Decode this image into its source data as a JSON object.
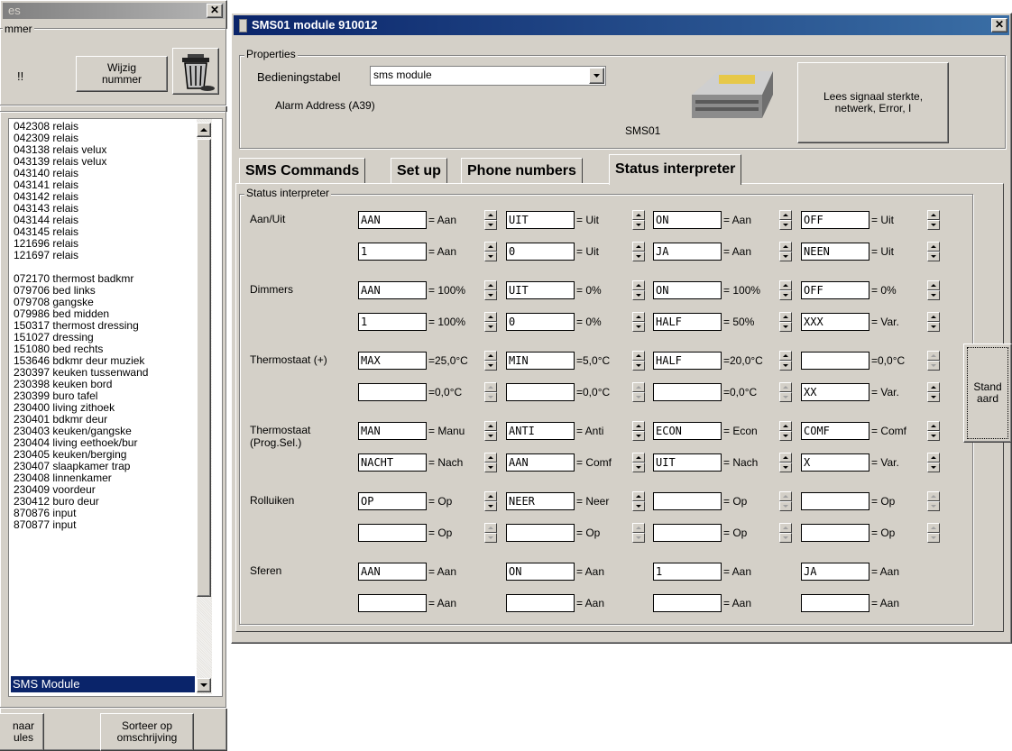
{
  "left_window": {
    "title": "es",
    "group_label": "mmer",
    "number_text": "!!",
    "wijzig_button": "Wijzig nummer",
    "list_items": [
      "042308 relais",
      "042309 relais",
      "043138 relais velux",
      "043139 relais velux",
      "043140 relais",
      "043141 relais",
      "043142 relais",
      "043143 relais",
      "043144 relais",
      "043145 relais",
      "121696 relais",
      "121697 relais",
      "",
      "072170 thermost badkmr",
      "079706 bed links",
      "079708 gangske",
      "079986 bed midden",
      "150317 thermost dressing",
      "151027 dressing",
      "151080 bed rechts",
      "153646 bdkmr deur muziek",
      "230397 keuken tussenwand",
      "230398 keuken bord",
      "230399 buro tafel",
      "230400 living zithoek",
      "230401 bdkmr deur",
      "230403 keuken/gangske",
      "230404 living eethoek/bur",
      "230405 keuken/berging",
      "230407 slaapkamer trap",
      "230408 linnenkamer",
      "230409 voordeur",
      "230412 buro deur",
      "870876 input",
      "870877 input"
    ],
    "selected_item": "SMS Module",
    "naar_button": "naar ules",
    "sorteer_button": "Sorteer op omschrijving"
  },
  "main_window": {
    "title": "SMS01 module 910012",
    "properties": {
      "group_label": "Properties",
      "bedieningstabel_label": "Bedieningstabel",
      "bedieningstabel_value": "sms module",
      "alarm_label": "Alarm Address (A39)",
      "image_caption": "SMS01",
      "lees_button": "Lees signaal sterkte, netwerk, Error, I"
    },
    "tabs": [
      "SMS Commands",
      "Set up",
      "Phone numbers",
      "Status interpreter"
    ],
    "active_tab": "Status interpreter",
    "status_group_label": "Status interpreter",
    "rows": [
      {
        "label": "Aan/Uit",
        "label2": "",
        "lines": [
          [
            {
              "v": "AAN",
              "t": "= Aan"
            },
            {
              "v": "UIT",
              "t": "= Uit"
            },
            {
              "v": "ON",
              "t": "= Aan"
            },
            {
              "v": "OFF",
              "t": "= Uit"
            }
          ],
          [
            {
              "v": "1",
              "t": "= Aan"
            },
            {
              "v": "0",
              "t": "= Uit"
            },
            {
              "v": "JA",
              "t": "= Aan"
            },
            {
              "v": "NEEN",
              "t": "= Uit"
            }
          ]
        ]
      },
      {
        "label": "Dimmers",
        "label2": "",
        "lines": [
          [
            {
              "v": "AAN",
              "t": "= 100%"
            },
            {
              "v": "UIT",
              "t": "= 0%"
            },
            {
              "v": "ON",
              "t": "= 100%"
            },
            {
              "v": "OFF",
              "t": "= 0%"
            }
          ],
          [
            {
              "v": "1",
              "t": "= 100%"
            },
            {
              "v": "0",
              "t": "= 0%"
            },
            {
              "v": "HALF",
              "t": "= 50%"
            },
            {
              "v": "XXX",
              "t": "= Var."
            }
          ]
        ]
      },
      {
        "label": "Thermostaat (+)",
        "label2": "",
        "lines": [
          [
            {
              "v": "MAX",
              "t": "=25,0°C"
            },
            {
              "v": "MIN",
              "t": "=5,0°C"
            },
            {
              "v": "HALF",
              "t": "=20,0°C"
            },
            {
              "v": "",
              "t": "=0,0°C"
            }
          ],
          [
            {
              "v": "",
              "t": "=0,0°C"
            },
            {
              "v": "",
              "t": "=0,0°C"
            },
            {
              "v": "",
              "t": "=0,0°C"
            },
            {
              "v": "XX",
              "t": "= Var."
            }
          ]
        ]
      },
      {
        "label": "Thermostaat",
        "label2": "(Prog.Sel.)",
        "lines": [
          [
            {
              "v": "MAN",
              "t": "= Manu"
            },
            {
              "v": "ANTI",
              "t": "= Anti"
            },
            {
              "v": "ECON",
              "t": "= Econ"
            },
            {
              "v": "COMF",
              "t": "= Comf"
            }
          ],
          [
            {
              "v": "NACHT",
              "t": "= Nach"
            },
            {
              "v": "AAN",
              "t": "= Comf"
            },
            {
              "v": "UIT",
              "t": "= Nach"
            },
            {
              "v": "X",
              "t": "= Var."
            }
          ]
        ]
      },
      {
        "label": "Rolluiken",
        "label2": "",
        "lines": [
          [
            {
              "v": "OP",
              "t": "= Op"
            },
            {
              "v": "NEER",
              "t": "= Neer"
            },
            {
              "v": "",
              "t": "= Op"
            },
            {
              "v": "",
              "t": "= Op"
            }
          ],
          [
            {
              "v": "",
              "t": "= Op"
            },
            {
              "v": "",
              "t": "= Op"
            },
            {
              "v": "",
              "t": "= Op"
            },
            {
              "v": "",
              "t": "= Op"
            }
          ]
        ]
      },
      {
        "label": "Sferen",
        "label2": "",
        "lines": [
          [
            {
              "v": "AAN",
              "t": "= Aan"
            },
            {
              "v": "ON",
              "t": "= Aan"
            },
            {
              "v": "1",
              "t": "= Aan"
            },
            {
              "v": "JA",
              "t": "= Aan"
            }
          ],
          [
            {
              "v": "",
              "t": "= Aan"
            },
            {
              "v": "",
              "t": "= Aan"
            },
            {
              "v": "",
              "t": "= Aan"
            },
            {
              "v": "",
              "t": "= Aan"
            }
          ]
        ]
      }
    ],
    "standaard_button": "Stand aard"
  }
}
